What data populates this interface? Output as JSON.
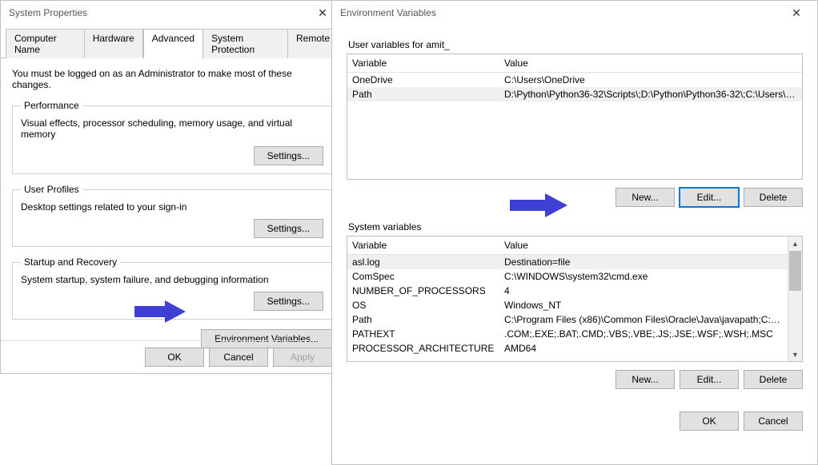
{
  "sysprops": {
    "title": "System Properties",
    "tabs": [
      "Computer Name",
      "Hardware",
      "Advanced",
      "System Protection",
      "Remote"
    ],
    "active_tab": "Advanced",
    "admin_note": "You must be logged on as an Administrator to make most of these changes.",
    "perf": {
      "legend": "Performance",
      "desc": "Visual effects, processor scheduling, memory usage, and virtual memory",
      "btn": "Settings..."
    },
    "profiles": {
      "legend": "User Profiles",
      "desc": "Desktop settings related to your sign-in",
      "btn": "Settings..."
    },
    "startup": {
      "legend": "Startup and Recovery",
      "desc": "System startup, system failure, and debugging information",
      "btn": "Settings..."
    },
    "env_btn": "Environment Variables...",
    "ok": "OK",
    "cancel": "Cancel",
    "apply": "Apply"
  },
  "env": {
    "title": "Environment Variables",
    "user_section": "User variables for amit_",
    "header_var": "Variable",
    "header_val": "Value",
    "user_rows": [
      {
        "var": "OneDrive",
        "val": "C:\\Users\\OneDrive"
      },
      {
        "var": "Path",
        "val": "D:\\Python\\Python36-32\\Scripts\\;D:\\Python\\Python36-32\\;C:\\Users\\am..."
      }
    ],
    "sys_section": "System variables",
    "sys_rows": [
      {
        "var": "asl.log",
        "val": "Destination=file"
      },
      {
        "var": "ComSpec",
        "val": "C:\\WINDOWS\\system32\\cmd.exe"
      },
      {
        "var": "NUMBER_OF_PROCESSORS",
        "val": "4"
      },
      {
        "var": "OS",
        "val": "Windows_NT"
      },
      {
        "var": "Path",
        "val": "C:\\Program Files (x86)\\Common Files\\Oracle\\Java\\javapath;C:\\Pro..."
      },
      {
        "var": "PATHEXT",
        "val": ".COM;.EXE;.BAT;.CMD;.VBS;.VBE;.JS;.JSE;.WSF;.WSH;.MSC"
      },
      {
        "var": "PROCESSOR_ARCHITECTURE",
        "val": "AMD64"
      }
    ],
    "new_btn": "New...",
    "edit_btn": "Edit...",
    "del_btn": "Delete",
    "ok": "OK",
    "cancel": "Cancel"
  }
}
